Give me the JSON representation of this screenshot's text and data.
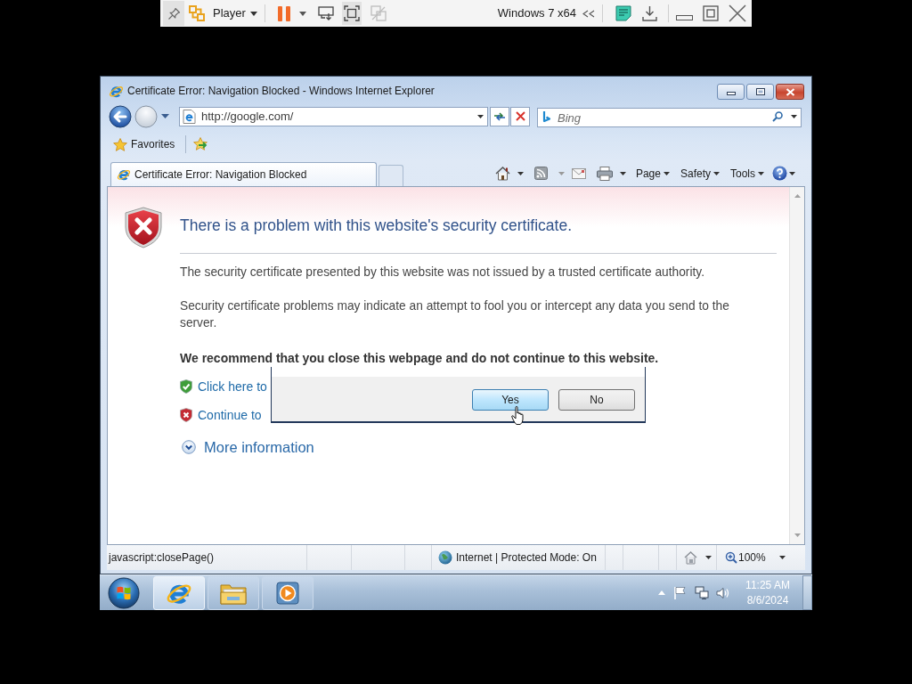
{
  "player_bar": {
    "menu": "Player",
    "vm_name": "Windows 7 x64"
  },
  "window": {
    "title": "Certificate Error: Navigation Blocked - Windows Internet Explorer"
  },
  "address_bar": {
    "value": "http://google.com/"
  },
  "search": {
    "placeholder": "Bing"
  },
  "favorites_bar": {
    "label": "Favorites"
  },
  "tabs": [
    {
      "label": "Certificate Error: Navigation Blocked",
      "selected": true
    }
  ],
  "command_bar": {
    "menus": [
      "Page",
      "Safety",
      "Tools"
    ]
  },
  "page": {
    "heading": "There is a problem with this website's security certificate.",
    "paragraphs": [
      "The security certificate presented by this website was not issued by a trusted certificate authority.",
      "Security certificate problems may indicate an attempt to fool you or intercept any data you send to the server."
    ],
    "recommendation": "We recommend that you close this webpage and do not continue to this website.",
    "options": [
      {
        "kind": "safe",
        "label": "Click here to"
      },
      {
        "kind": "unsafe",
        "label": "Continue to"
      }
    ],
    "more_info": "More information"
  },
  "dialog": {
    "buttons": [
      {
        "label": "Yes",
        "hovered": true
      },
      {
        "label": "No",
        "hovered": false
      }
    ]
  },
  "status_bar": {
    "text": "javascript:closePage()",
    "zone": "Internet | Protected Mode: On",
    "zoom": "100%"
  },
  "taskbar": {
    "apps": [
      {
        "kind": "browser",
        "active": true
      },
      {
        "kind": "folder",
        "active": false
      },
      {
        "kind": "media",
        "active": false
      }
    ],
    "clock": {
      "time": "11:25 AM",
      "date": "8/6/2024"
    }
  }
}
